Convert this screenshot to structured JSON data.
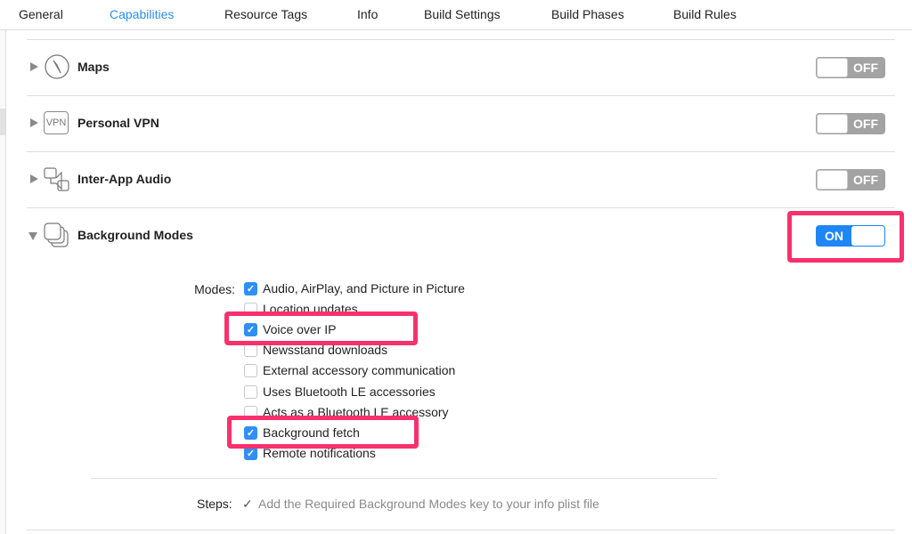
{
  "tabs": [
    {
      "label": "General"
    },
    {
      "label": "Capabilities",
      "active": true
    },
    {
      "label": "Resource Tags"
    },
    {
      "label": "Info"
    },
    {
      "label": "Build Settings"
    },
    {
      "label": "Build Phases"
    },
    {
      "label": "Build Rules"
    }
  ],
  "capabilities": [
    {
      "name": "Maps",
      "icon": "compass-icon",
      "state": "OFF",
      "expanded": false
    },
    {
      "name": "Personal VPN",
      "icon": "vpn-icon",
      "icon_text": "VPN",
      "state": "OFF",
      "expanded": false
    },
    {
      "name": "Inter-App Audio",
      "icon": "inter-app-audio-icon",
      "state": "OFF",
      "expanded": false
    },
    {
      "name": "Background Modes",
      "icon": "background-modes-icon",
      "state": "ON",
      "expanded": true
    }
  ],
  "modes_label": "Modes:",
  "modes": [
    {
      "label": "Audio, AirPlay, and Picture in Picture",
      "checked": true
    },
    {
      "label": "Location updates",
      "checked": false
    },
    {
      "label": "Voice over IP",
      "checked": true
    },
    {
      "label": "Newsstand downloads",
      "checked": false
    },
    {
      "label": "External accessory communication",
      "checked": false
    },
    {
      "label": "Uses Bluetooth LE accessories",
      "checked": false
    },
    {
      "label": "Acts as a Bluetooth LE accessory",
      "checked": false
    },
    {
      "label": "Background fetch",
      "checked": true
    },
    {
      "label": "Remote notifications",
      "checked": true
    }
  ],
  "steps": {
    "label": "Steps:",
    "check": "✓",
    "text": "Add the Required Background Modes key to your info plist file"
  },
  "colors": {
    "accent": "#2f8ce6",
    "toggle_on": "#1f86f5",
    "highlight": "#f8316d"
  }
}
